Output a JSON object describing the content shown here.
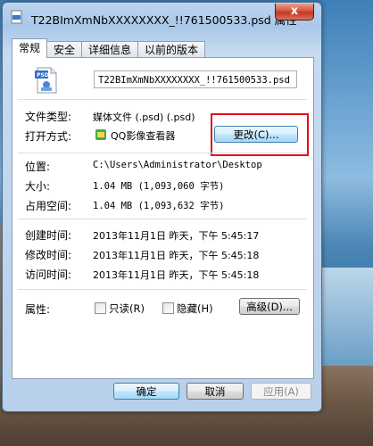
{
  "window": {
    "title": "T22BImXmNbXXXXXXXX_!!761500533.psd 属性",
    "close_label": "x"
  },
  "tabs": [
    {
      "label": "常规"
    },
    {
      "label": "安全"
    },
    {
      "label": "详细信息"
    },
    {
      "label": "以前的版本"
    }
  ],
  "general": {
    "filename": "T22BImXmNbXXXXXXXX_!!761500533.psd",
    "file_type_label": "文件类型:",
    "file_type_value": "媒体文件 (.psd) (.psd)",
    "open_with_label": "打开方式:",
    "open_with_value": "QQ影像查看器",
    "change_button": "更改(C)...",
    "location_label": "位置:",
    "location_value": "C:\\Users\\Administrator\\Desktop",
    "size_label": "大小:",
    "size_value": "1.04 MB (1,093,060 字节)",
    "size_on_disk_label": "占用空间:",
    "size_on_disk_value": "1.04 MB (1,093,632 字节)",
    "created_label": "创建时间:",
    "created_value": "2013年11月1日 昨天，下午 5:45:17",
    "modified_label": "修改时间:",
    "modified_value": "2013年11月1日 昨天，下午 5:45:18",
    "accessed_label": "访问时间:",
    "accessed_value": "2013年11月1日 昨天，下午 5:45:18",
    "attributes_label": "属性:",
    "readonly_label": "只读(R)",
    "hidden_label": "隐藏(H)",
    "advanced_button": "高级(D)...",
    "readonly_checked": false,
    "hidden_checked": false
  },
  "footer": {
    "ok": "确定",
    "cancel": "取消",
    "apply": "应用(A)"
  },
  "colors": {
    "highlight_box": "#e0101a",
    "accent": "#3c7fb1"
  }
}
